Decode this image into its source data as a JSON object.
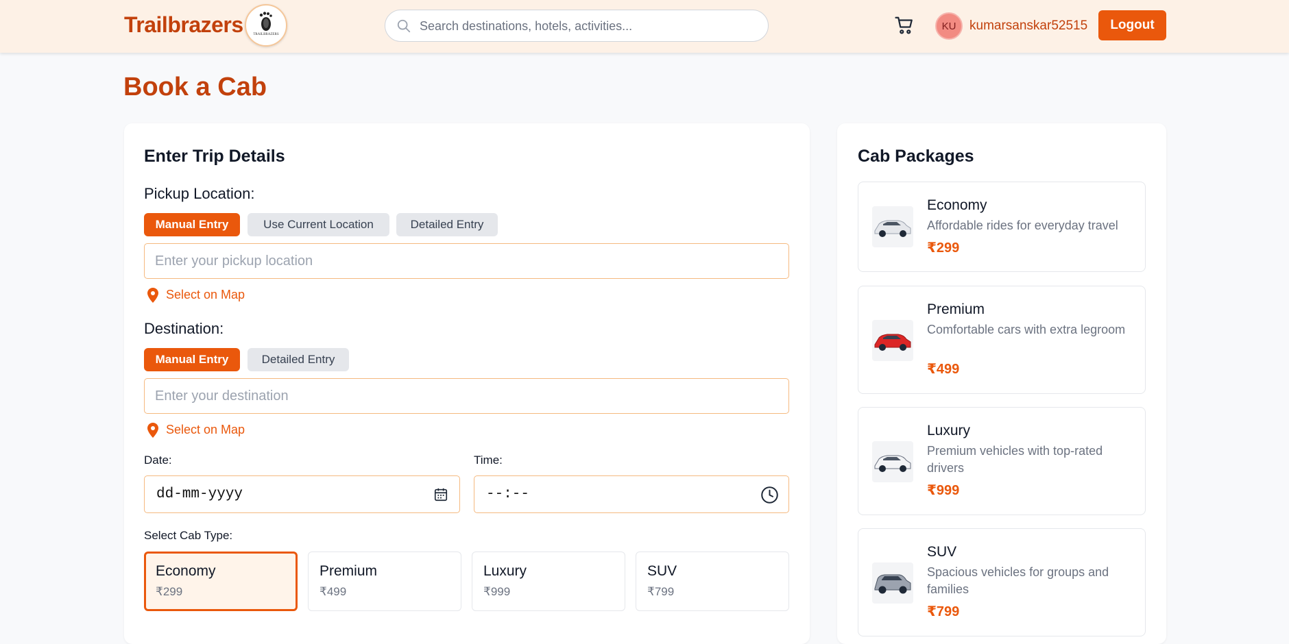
{
  "header": {
    "brand": "Trailbrazers",
    "logo_text": "TRAILBRAZERS",
    "search_placeholder": "Search destinations, hotels, activities...",
    "avatar_initials": "KU",
    "username": "kumarsanskar52515",
    "logout_label": "Logout"
  },
  "page_title": "Book a Cab",
  "trip": {
    "heading": "Enter Trip Details",
    "pickup": {
      "label": "Pickup Location:",
      "tabs": [
        "Manual Entry",
        "Use Current Location",
        "Detailed Entry"
      ],
      "active_tab": "Manual Entry",
      "placeholder": "Enter your pickup location",
      "value": "",
      "map_link": "Select on Map"
    },
    "destination": {
      "label": "Destination:",
      "tabs": [
        "Manual Entry",
        "Detailed Entry"
      ],
      "active_tab": "Manual Entry",
      "placeholder": "Enter your destination",
      "value": "",
      "map_link": "Select on Map"
    },
    "date": {
      "label": "Date:",
      "value": "dd-mm-yyyy"
    },
    "time": {
      "label": "Time:",
      "value": "--:--"
    },
    "cab_type": {
      "label": "Select Cab Type:",
      "selected": "Economy",
      "options": [
        {
          "name": "Economy",
          "price": "₹299"
        },
        {
          "name": "Premium",
          "price": "₹499"
        },
        {
          "name": "Luxury",
          "price": "₹999"
        },
        {
          "name": "SUV",
          "price": "₹799"
        }
      ]
    }
  },
  "packages": {
    "heading": "Cab Packages",
    "items": [
      {
        "name": "Economy",
        "description": "Affordable rides for everyday travel",
        "price": "₹299",
        "car_color": "#e5e7eb"
      },
      {
        "name": "Premium",
        "description": "Comfortable cars with extra legroom",
        "price": "₹499",
        "car_color": "#dc2626"
      },
      {
        "name": "Luxury",
        "description": "Premium vehicles with top-rated drivers",
        "price": "₹999",
        "car_color": "#f3f4f6"
      },
      {
        "name": "SUV",
        "description": "Spacious vehicles for groups and families",
        "price": "₹799",
        "car_color": "#9ca3af"
      }
    ]
  },
  "colors": {
    "accent": "#ea580c",
    "brand": "#c2410c",
    "header_bg": "#fdf1e6",
    "selected_bg": "#fff4ea"
  }
}
